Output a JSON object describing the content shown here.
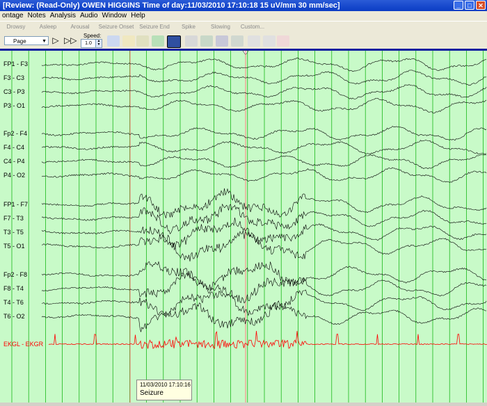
{
  "window": {
    "title": "[Review: (Read-Only)   OWEN HIGGINS   Time of day:11/03/2010 17:10:18   15 uV/mm   30 mm/sec]"
  },
  "menu": [
    "ontage",
    "Notes",
    "Analysis",
    "Audio",
    "Window",
    "Help"
  ],
  "events": [
    "Drowsy",
    "Asleep",
    "Arousal",
    "Seizure Onset",
    "Seizure End",
    "Spike",
    "Slowing",
    "Custom..."
  ],
  "toolbar": {
    "page_label": "Page",
    "speed_label": "Speed:",
    "speed_value": "1.0"
  },
  "channels": {
    "group1": [
      "FP1 - F3",
      "F3 - C3",
      "C3 - P3",
      "P3 - O1"
    ],
    "group2": [
      "Fp2 - F4",
      "F4 - C4",
      "C4 - P4",
      "P4 - O2"
    ],
    "group3": [
      "FP1 - F7",
      "F7 - T3",
      "T3 - T5",
      "T5 - O1"
    ],
    "group4": [
      "Fp2 - F8",
      "F8 - T4",
      "T4 - T6",
      "T6 - O2"
    ],
    "ekg": "EKGL - EKGR"
  },
  "annotation": {
    "time": "11/03/2010 17:10:16",
    "label": "Seizure"
  },
  "colors": {
    "grid": "#c8fac8",
    "gridline": "#00b000",
    "marker": "#ff8080",
    "ekg": "#ff0000",
    "trace": "#000000"
  }
}
